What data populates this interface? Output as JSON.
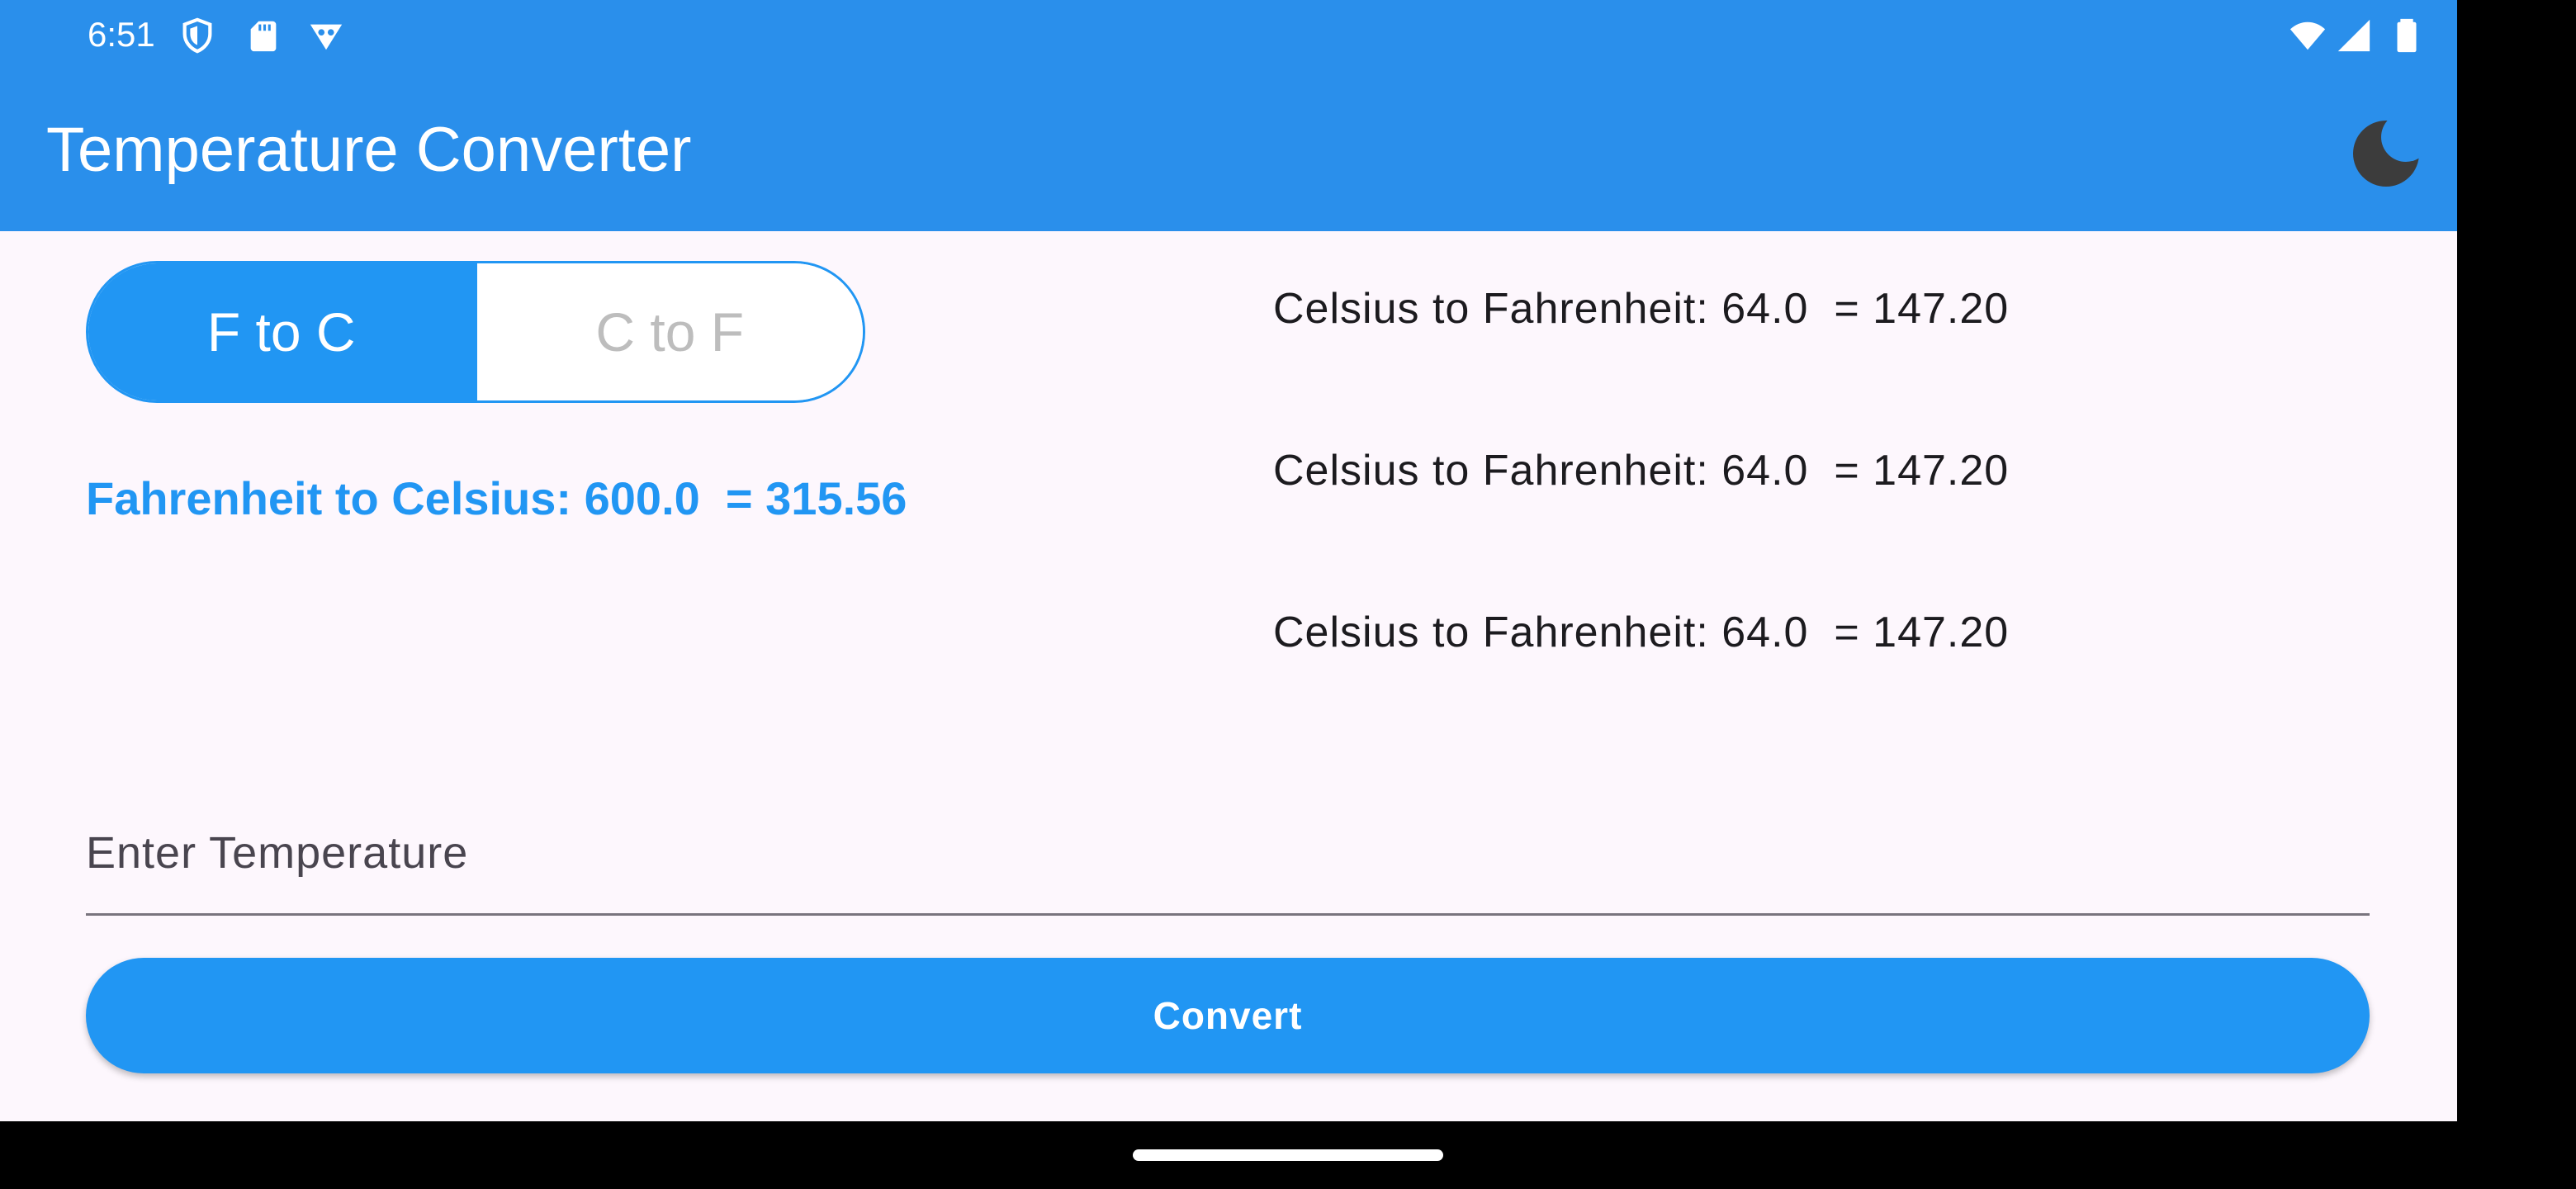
{
  "status_bar": {
    "time": "6:51",
    "left_icons": [
      "shield-icon",
      "sd-card-icon",
      "vpn-key-icon"
    ],
    "right_icons": [
      "wifi-icon",
      "signal-icon",
      "battery-icon"
    ]
  },
  "app_bar": {
    "title": "Temperature Converter",
    "theme_toggle_icon": "moon-icon"
  },
  "mode_selector": {
    "options": [
      {
        "label": "F to C",
        "selected": true
      },
      {
        "label": "C to F",
        "selected": false
      }
    ]
  },
  "current_result": "Fahrenheit to Celsius: 600.0  = 315.56",
  "history": [
    "Celsius to Fahrenheit: 64.0  = 147.20",
    "Celsius to Fahrenheit: 64.0  = 147.20",
    "Celsius to Fahrenheit: 64.0  = 147.20"
  ],
  "input": {
    "placeholder": "Enter Temperature",
    "value": ""
  },
  "convert_button": {
    "label": "Convert"
  },
  "colors": {
    "app_bar": "#2A8FEB",
    "primary": "#2196F3",
    "background": "#FDF7FD",
    "text": "#1C1B1F",
    "inactive_text": "#BDBDBD"
  }
}
